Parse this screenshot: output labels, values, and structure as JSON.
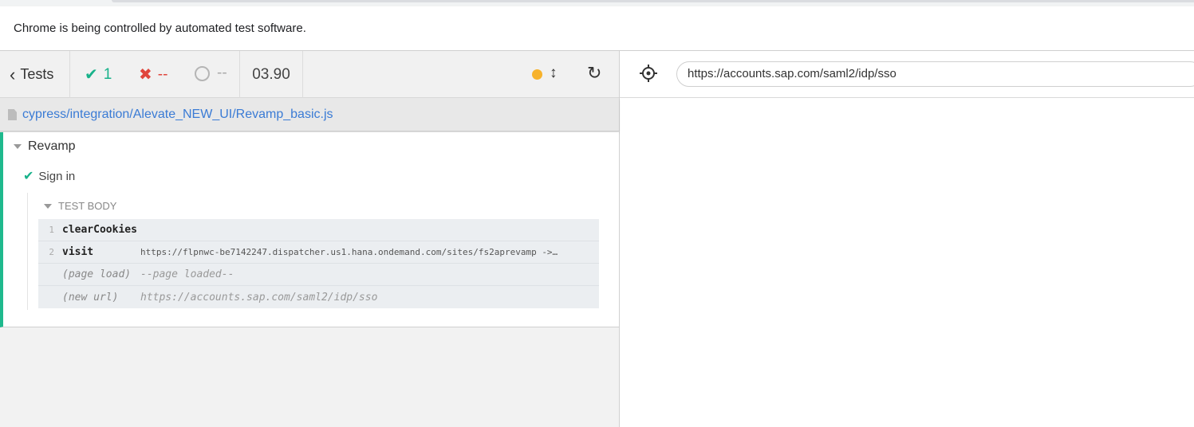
{
  "browser": {
    "infobar_text": "Chrome is being controlled by automated test software."
  },
  "runner": {
    "tests_label": "Tests",
    "passed": "1",
    "failed": "--",
    "pending": "--",
    "duration": "03.90",
    "status_dot_color": "#f7b22b",
    "accent_pass": "#18b28a",
    "accent_fail": "#e0463d"
  },
  "aut": {
    "url": "https://accounts.sap.com/saml2/idp/sso"
  },
  "spec": {
    "path": "cypress/integration/Alevate_NEW_UI/Revamp_basic.js"
  },
  "reporter": {
    "suite_title": "Revamp",
    "test_title": "Sign in",
    "section_label": "TEST BODY",
    "commands": [
      {
        "num": "1",
        "name": "clearCookies",
        "message": ""
      },
      {
        "num": "2",
        "name": "visit",
        "message": "https://flpnwc-be7142247.dispatcher.us1.hana.ondemand.com/sites/fs2aprevamp ->…"
      },
      {
        "num": "",
        "name": "(page load)",
        "message": "--page loaded--"
      },
      {
        "num": "",
        "name": "(new url)",
        "message": "https://accounts.sap.com/saml2/idp/sso"
      }
    ]
  }
}
